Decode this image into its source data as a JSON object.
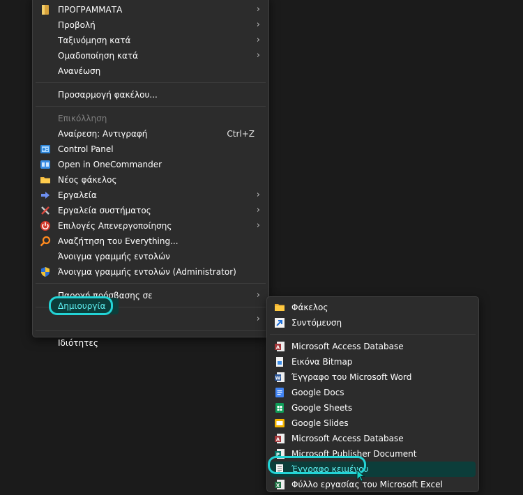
{
  "main_menu": {
    "items": [
      {
        "label": "ΠΡΟΓΡΑΜΜΑΤΑ",
        "icon": "yellow-folder-icon",
        "submenu": true
      },
      {
        "label": "Προβολή",
        "submenu": true
      },
      {
        "label": "Ταξινόμηση κατά",
        "submenu": true
      },
      {
        "label": "Ομαδοποίηση κατά",
        "submenu": true
      },
      {
        "label": "Ανανέωση"
      },
      {
        "label": "Προσαρμογή φακέλου..."
      },
      {
        "label": "Επικόλληση",
        "disabled": true
      },
      {
        "label": "Αναίρεση: Αντιγραφή",
        "shortcut": "Ctrl+Z"
      },
      {
        "label": "Control Panel",
        "icon": "control-panel-icon"
      },
      {
        "label": "Open in OneCommander",
        "icon": "onecommander-icon"
      },
      {
        "label": "Νέος φάκελος",
        "icon": "new-folder-icon"
      },
      {
        "label": "Εργαλεία",
        "icon": "tools-arrow-icon",
        "submenu": true
      },
      {
        "label": "Εργαλεία συστήματος",
        "icon": "system-tools-icon",
        "submenu": true
      },
      {
        "label": "Επιλογές Απενεργοποίησης",
        "icon": "power-icon",
        "submenu": true
      },
      {
        "label": "Αναζήτηση του Everything...",
        "icon": "everything-search-icon"
      },
      {
        "label": "Άνοιγμα γραμμής εντολών"
      },
      {
        "label": "Άνοιγμα γραμμής εντολών (Administrator)",
        "icon": "uac-shield-icon"
      },
      {
        "label": "Παροχή πρόσβασης σε",
        "submenu": true
      },
      {
        "label": "Δημιουργία",
        "submenu": true,
        "highlighted": true
      },
      {
        "label": "Ιδιότητες"
      }
    ]
  },
  "new_submenu": {
    "items": [
      {
        "label": "Φάκελος",
        "icon": "folder-icon"
      },
      {
        "label": "Συντόμευση",
        "icon": "shortcut-icon"
      },
      {
        "label": "Microsoft Access Database",
        "icon": "access-icon"
      },
      {
        "label": "Εικόνα Bitmap",
        "icon": "bitmap-icon"
      },
      {
        "label": "Έγγραφο του Microsoft Word",
        "icon": "word-icon"
      },
      {
        "label": "Google Docs",
        "icon": "google-docs-icon"
      },
      {
        "label": "Google Sheets",
        "icon": "google-sheets-icon"
      },
      {
        "label": "Google Slides",
        "icon": "google-slides-icon"
      },
      {
        "label": "Microsoft Access Database",
        "icon": "access-icon"
      },
      {
        "label": "Microsoft Publisher Document",
        "icon": "publisher-icon"
      },
      {
        "label": "Έγγραφο κειμένου",
        "icon": "text-document-icon",
        "highlighted": true
      },
      {
        "label": "Φύλλο εργασίας του Microsoft Excel",
        "icon": "excel-icon"
      }
    ]
  },
  "colors": {
    "menu_bg": "#2c2c2c",
    "desktop_bg": "#1b1b1b",
    "annotation_cyan": "#23d4d6",
    "highlight_bg": "#0c3d3a",
    "disabled_text": "#7e7e7e"
  }
}
